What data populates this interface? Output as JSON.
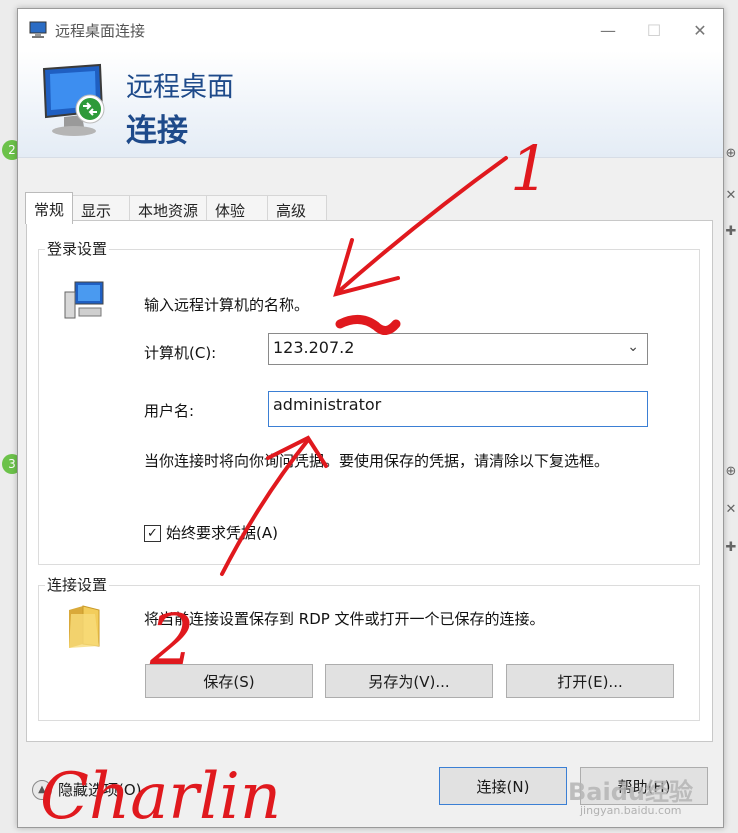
{
  "window": {
    "title": "远程桌面连接"
  },
  "banner": {
    "line1": "远程桌面",
    "line2": "连接"
  },
  "tabs": [
    "常规",
    "显示",
    "本地资源",
    "体验",
    "高级"
  ],
  "login": {
    "legend": "登录设置",
    "prompt": "输入远程计算机的名称。",
    "computer_label": "计算机(C):",
    "computer_value": "123.207.2",
    "user_label": "用户名:",
    "user_value": "administrator",
    "note": "当你连接时将向你询问凭据。要使用保存的凭据，请清除以下复选框。",
    "checkbox_label": "始终要求凭据(A)",
    "checkbox_checked": true
  },
  "conn": {
    "legend": "连接设置",
    "desc": "将当前连接设置保存到 RDP 文件或打开一个已保存的连接。",
    "save": "保存(S)",
    "saveas": "另存为(V)...",
    "open": "打开(E)..."
  },
  "footer": {
    "options": "隐藏选项(O)",
    "connect": "连接(N)",
    "help": "帮助(H)"
  },
  "annotations": {
    "mark1": "1",
    "mark2": "2",
    "signature": "Charlin"
  },
  "watermark": {
    "brand": "Baidu经验",
    "url": "jingyan.baidu.com"
  },
  "colors": {
    "title_blue": "#1e4a8a",
    "focus_blue": "#3b7fd4",
    "annotation_red": "#e0191e"
  }
}
